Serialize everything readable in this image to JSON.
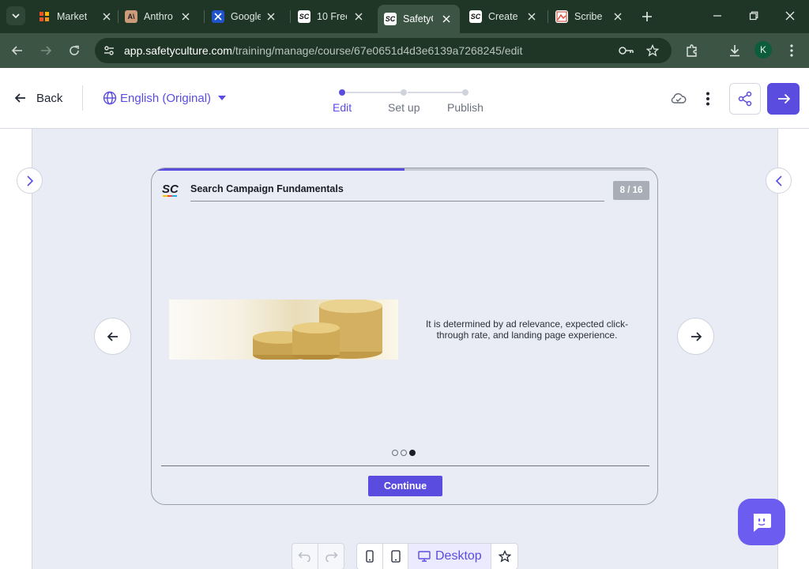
{
  "browser": {
    "tabs": [
      {
        "title": "Market",
        "favicon": "marketing-favicon"
      },
      {
        "title": "Anthro",
        "favicon": "anthropic-favicon"
      },
      {
        "title": "Google",
        "favicon": "google-favicon"
      },
      {
        "title": "10 Free",
        "favicon": "safetyculture-favicon"
      },
      {
        "title": "SafetyC",
        "favicon": "safetyculture-favicon",
        "active": true
      },
      {
        "title": "Create",
        "favicon": "safetyculture-favicon"
      },
      {
        "title": "Scribe",
        "favicon": "scribe-favicon"
      }
    ],
    "url_host": "app.safetyculture.com",
    "url_path": "/training/manage/course/67e0651d4d3e6139a7268245/edit",
    "profile_initial": "K"
  },
  "header": {
    "back_label": "Back",
    "language_label": "English (Original)",
    "steps": [
      {
        "label": "Edit",
        "active": true
      },
      {
        "label": "Set up",
        "active": false
      },
      {
        "label": "Publish",
        "active": false
      }
    ]
  },
  "slide": {
    "course_title": "Search Campaign Fundamentals",
    "counter": "8 / 16",
    "progress_fraction": 0.5,
    "image_alt": "stacked gold coins",
    "text": "It is determined by ad relevance, expected click-through rate, and landing page experience.",
    "dots_total": 3,
    "dots_active_index": 2,
    "continue_label": "Continue"
  },
  "toolbar": {
    "desktop_label": "Desktop"
  },
  "colors": {
    "accent": "#5b4ce0",
    "browser_frame": "#1f3525",
    "canvas_bg": "#e9ecf5"
  }
}
